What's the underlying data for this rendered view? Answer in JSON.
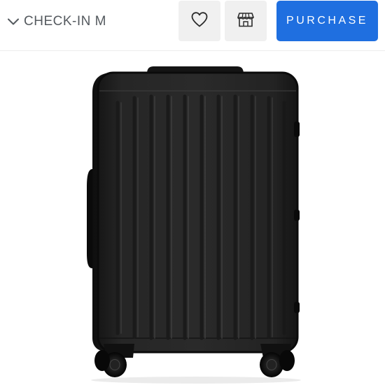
{
  "header": {
    "size_selector": {
      "label": "CHECK-IN M",
      "icon": "chevron-down-icon"
    },
    "wishlist_button": {
      "icon": "heart-icon"
    },
    "store_button": {
      "icon": "store-icon"
    },
    "purchase_button": {
      "label": "PURCHASE"
    }
  },
  "product": {
    "image_icon": "suitcase-image"
  },
  "colors": {
    "accent": "#1f6fe0",
    "icon_button_bg": "#f0f0f0",
    "text_gray": "#555a5f",
    "suitcase": "#1c1c1c"
  }
}
